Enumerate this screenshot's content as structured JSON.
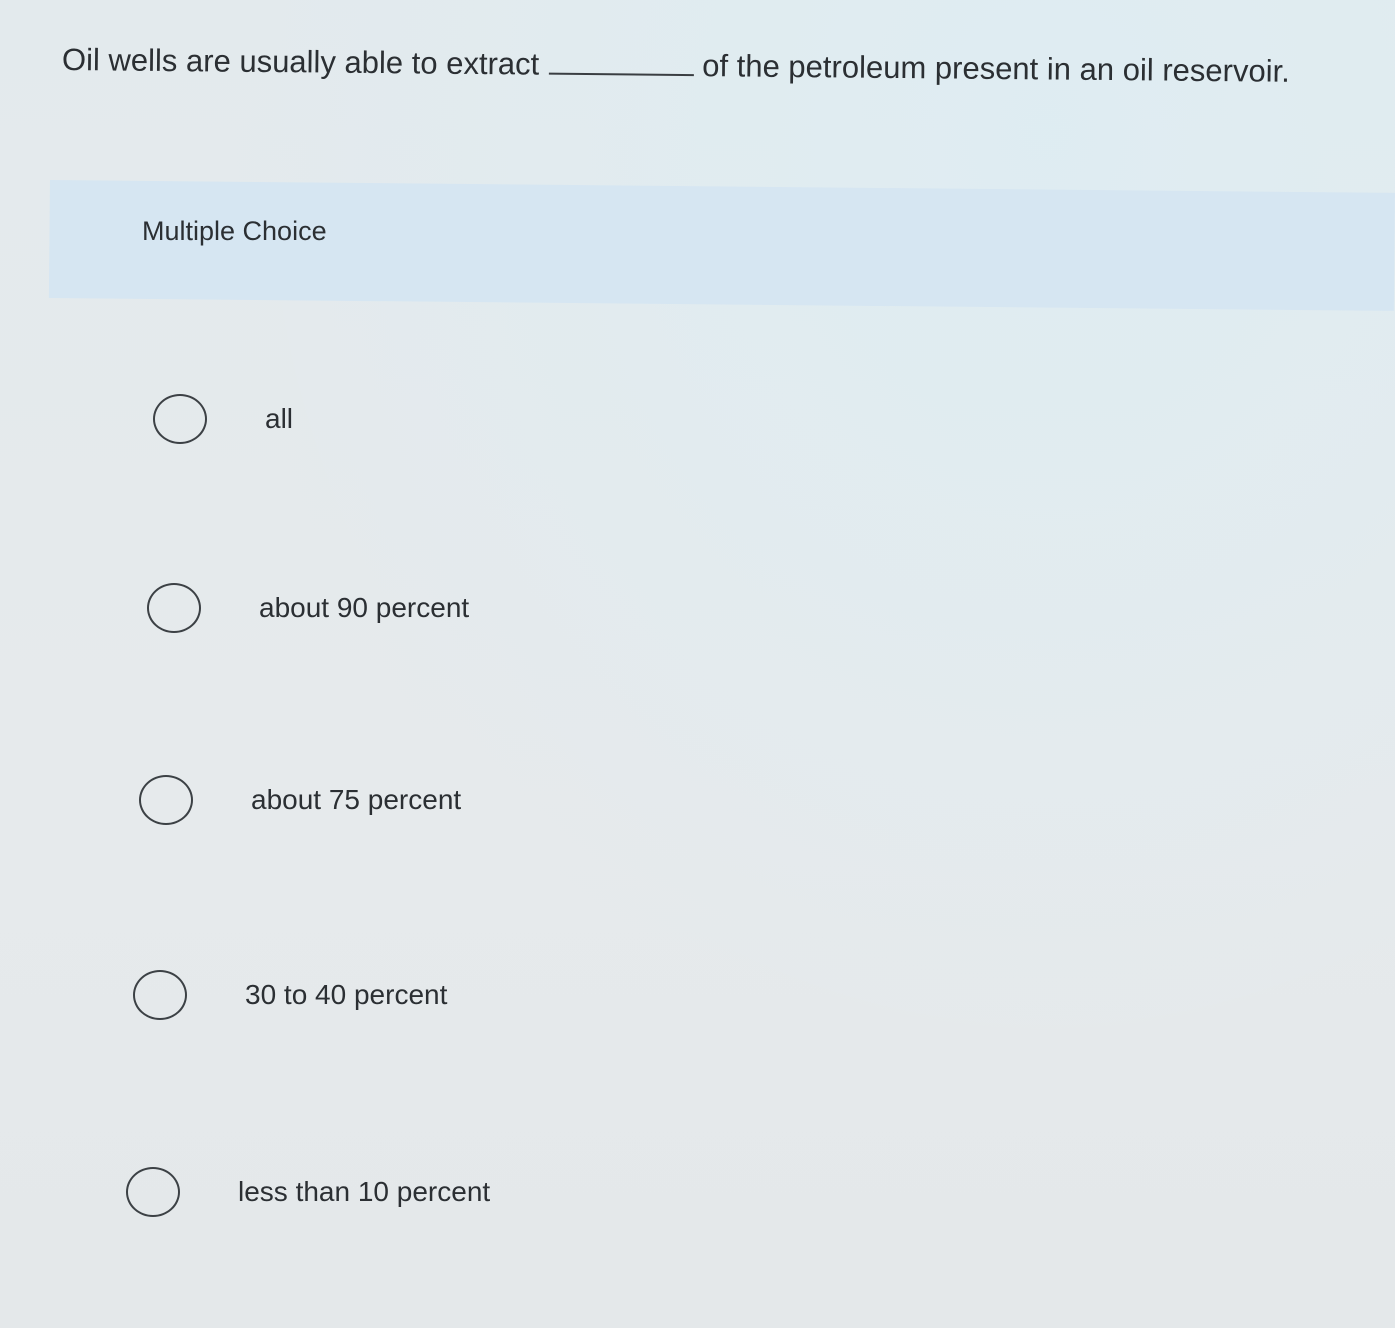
{
  "question": {
    "text_before": "Oil wells are usually able to extract",
    "text_after": "of the petroleum present in an oil reservoir."
  },
  "section": {
    "label": "Multiple Choice"
  },
  "options": [
    {
      "label": "all",
      "selected": false
    },
    {
      "label": "about 90 percent",
      "selected": false
    },
    {
      "label": "about 75 percent",
      "selected": false
    },
    {
      "label": "30 to 40 percent",
      "selected": false
    },
    {
      "label": "less than 10 percent",
      "selected": false
    }
  ]
}
